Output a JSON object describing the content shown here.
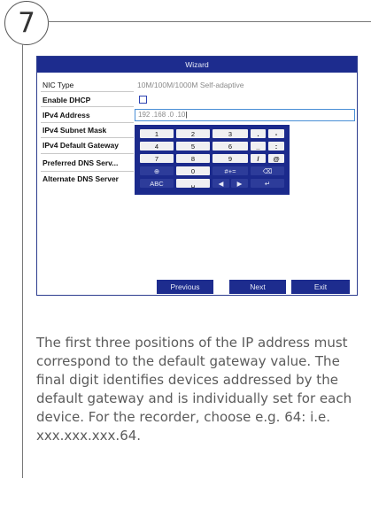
{
  "step": {
    "number": "7"
  },
  "wizard": {
    "title": "Wizard",
    "fields": {
      "nic_type_label": "NIC Type",
      "nic_type_value": "10M/100M/1000M Self-adaptive",
      "enable_dhcp_label": "Enable DHCP",
      "ipv4_address_label": "IPv4 Address",
      "ipv4_address_value": "192 .168 .0   .10",
      "ipv4_subnet_label": "IPv4 Subnet Mask",
      "ipv4_gateway_label": "IPv4 Default Gateway",
      "preferred_dns_label": "Preferred DNS Serv...",
      "alternate_dns_label": "Alternate DNS Server"
    },
    "keyboard": {
      "row1": [
        "1",
        "2",
        "3",
        ".",
        "-"
      ],
      "row2": [
        "4",
        "5",
        "6",
        "_",
        ":"
      ],
      "row3": [
        "7",
        "8",
        "9",
        "/",
        "@"
      ],
      "row4": [
        "⊕",
        "0",
        "#+=",
        "⌫"
      ],
      "row5": [
        "ABC",
        "␣",
        "◀",
        "▶",
        "↵"
      ]
    },
    "buttons": {
      "previous": "Previous",
      "next": "Next",
      "exit": "Exit"
    }
  },
  "description": "The first three positions of the IP address must correspond to the default gateway value. The final digit identifies devices addressed by the default gateway and is individually set for each device. For the recorder, choose e.g. 64: i.e. xxx.xxx.xxx.64."
}
